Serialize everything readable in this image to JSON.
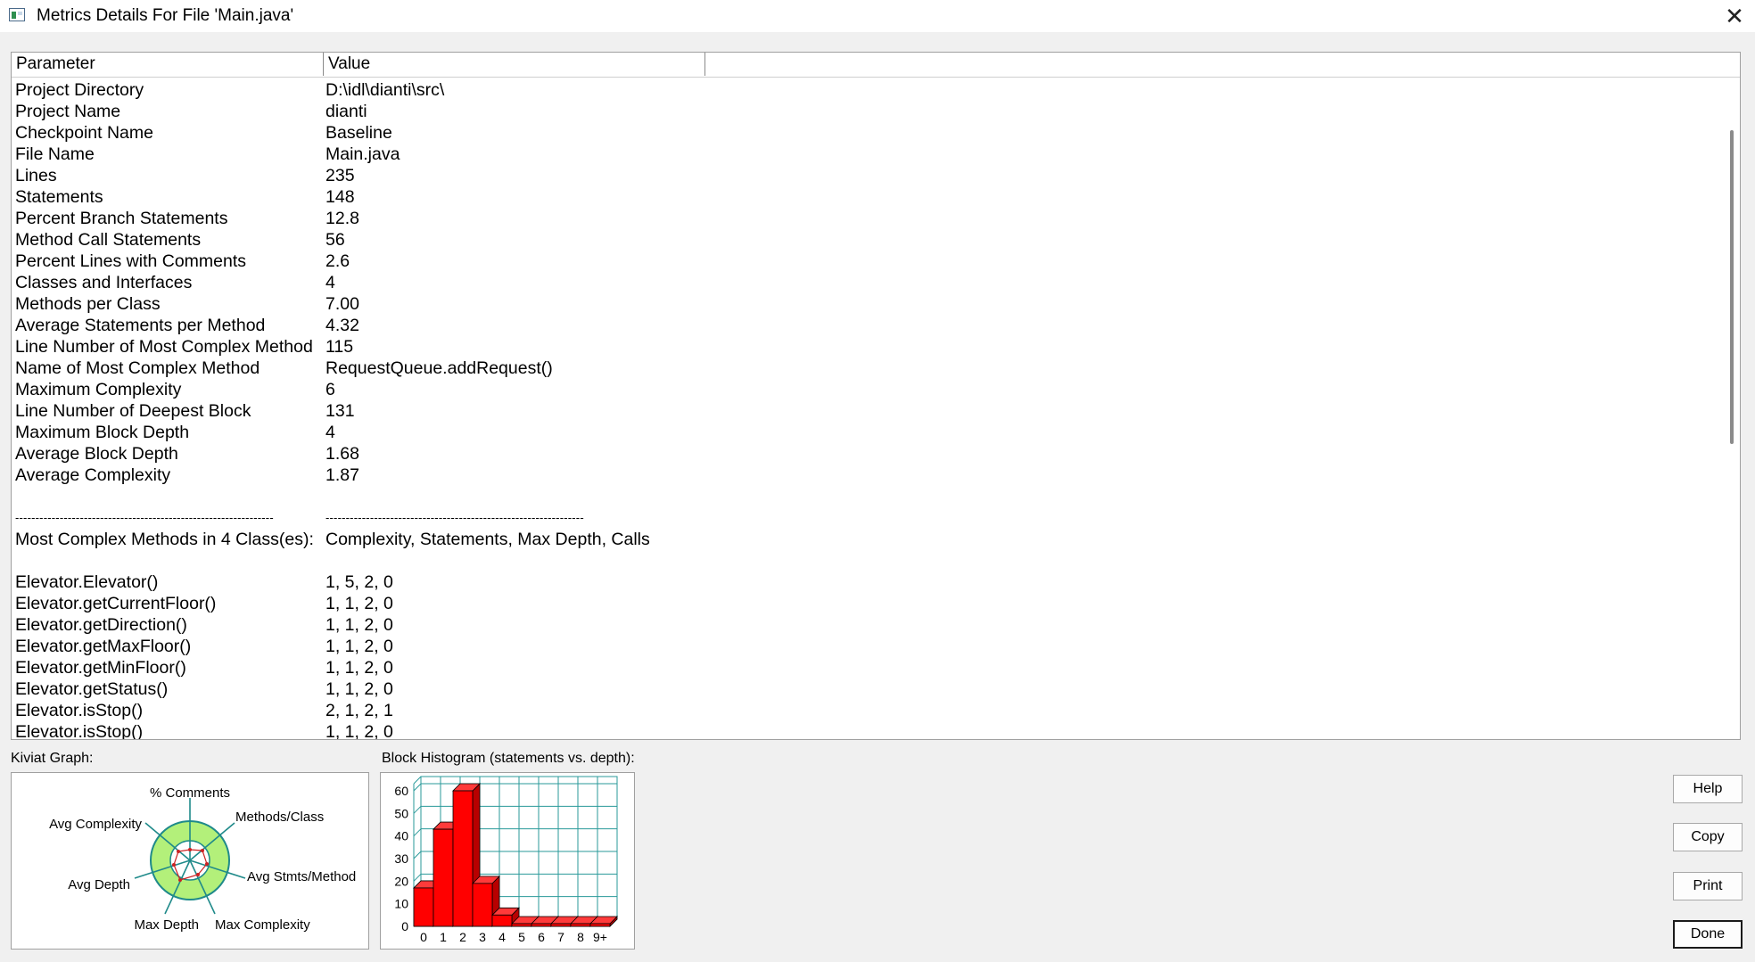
{
  "window": {
    "title": "Metrics Details For File 'Main.java'",
    "close_glyph": "✕"
  },
  "table": {
    "headers": {
      "parameter": "Parameter",
      "value": "Value"
    },
    "rows": [
      [
        "Project Directory",
        "D:\\idl\\dianti\\src\\"
      ],
      [
        "Project Name",
        "dianti"
      ],
      [
        "Checkpoint Name",
        "Baseline"
      ],
      [
        "File Name",
        "Main.java"
      ],
      [
        "Lines",
        "235"
      ],
      [
        "Statements",
        "148"
      ],
      [
        "Percent Branch Statements",
        "12.8"
      ],
      [
        "Method Call Statements",
        "56"
      ],
      [
        "Percent Lines with Comments",
        "2.6"
      ],
      [
        "Classes and Interfaces",
        "4"
      ],
      [
        "Methods per Class",
        "7.00"
      ],
      [
        "Average Statements per Method",
        "4.32"
      ],
      [
        "Line Number of Most Complex Method",
        "115"
      ],
      [
        "Name of Most Complex Method",
        "RequestQueue.addRequest()"
      ],
      [
        "Maximum Complexity",
        "6"
      ],
      [
        "Line Number of Deepest Block",
        "131"
      ],
      [
        "Maximum Block Depth",
        "4"
      ],
      [
        "Average Block Depth",
        "1.68"
      ],
      [
        "Average Complexity",
        "1.87"
      ],
      [
        "",
        ""
      ],
      [
        "----------------------------------------------------------------",
        "----------------------------------------------------------------"
      ],
      [
        "Most Complex Methods in 4 Class(es):",
        "Complexity, Statements, Max Depth, Calls"
      ],
      [
        "",
        ""
      ],
      [
        "Elevator.Elevator()",
        "1, 5, 2, 0"
      ],
      [
        "Elevator.getCurrentFloor()",
        "1, 1, 2, 0"
      ],
      [
        "Elevator.getDirection()",
        "1, 1, 2, 0"
      ],
      [
        "Elevator.getMaxFloor()",
        "1, 1, 2, 0"
      ],
      [
        "Elevator.getMinFloor()",
        "1, 1, 2, 0"
      ],
      [
        "Elevator.getStatus()",
        "1, 1, 2, 0"
      ],
      [
        "Elevator.isStop()",
        "2, 1, 2, 1"
      ],
      [
        "Elevator.isStop()",
        "1, 1, 2, 0"
      ]
    ]
  },
  "kiviat": {
    "label": "Kiviat Graph:",
    "axes": [
      "% Comments",
      "Methods/Class",
      "Avg Stmts/Method",
      "Max Complexity",
      "Max Depth",
      "Avg Depth",
      "Avg Complexity"
    ]
  },
  "histogram": {
    "label": "Block Histogram (statements vs. depth):"
  },
  "chart_data": {
    "type": "bar",
    "categories": [
      "0",
      "1",
      "2",
      "3",
      "4",
      "5",
      "6",
      "7",
      "8",
      "9+"
    ],
    "values": [
      17,
      43,
      60,
      19,
      5,
      0,
      0,
      0,
      0,
      0
    ],
    "ylim": [
      0,
      60
    ],
    "yticks": [
      0,
      10,
      20,
      30,
      40,
      50,
      60
    ],
    "grid": true,
    "bar_color": "#ff0000"
  },
  "buttons": {
    "help": "Help",
    "copy": "Copy",
    "print": "Print",
    "done": "Done"
  },
  "colors": {
    "kiviat_ring": "#b3f07a",
    "kiviat_spokes": "#1f8a8a",
    "grid": "#2a9a9a"
  }
}
